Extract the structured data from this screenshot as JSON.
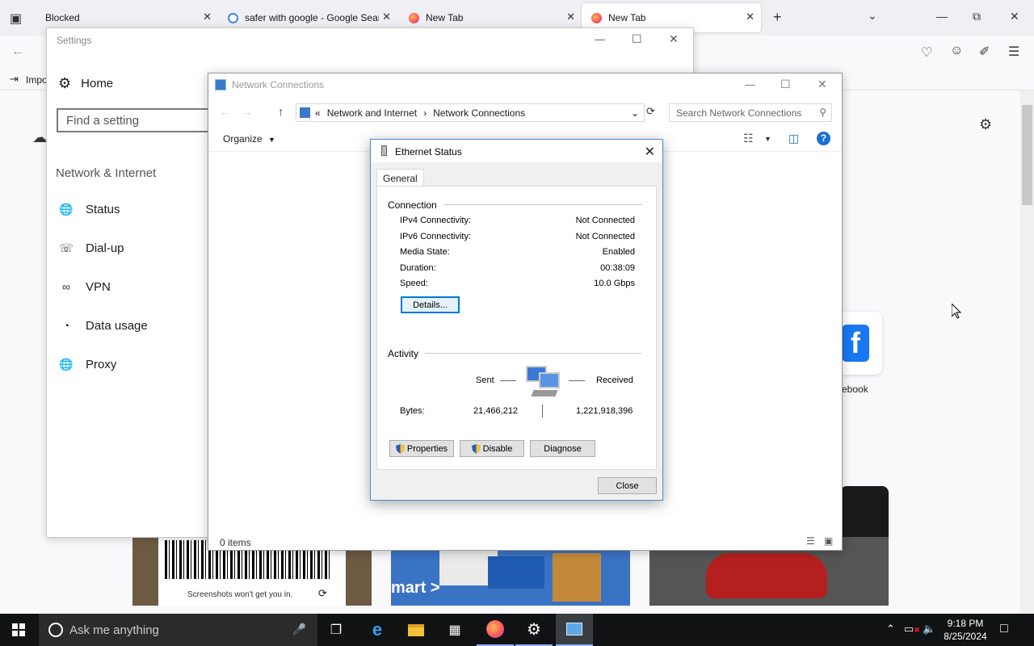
{
  "browser": {
    "tabs": [
      {
        "title": "Blocked",
        "active": false
      },
      {
        "title": "safer with google - Google Sear",
        "active": false
      },
      {
        "title": "New Tab",
        "active": false
      },
      {
        "title": "New Tab",
        "active": true
      }
    ],
    "bookmark_import": "Impo",
    "shortcut_label": "ebook",
    "tile_caption": "Screenshots won't get you in.",
    "tile_walmart_text": "mart >"
  },
  "settings": {
    "window_title": "Settings",
    "home_label": "Home",
    "search_placeholder": "Find a setting",
    "section_title": "Network & Internet",
    "nav": [
      {
        "label": "Status",
        "icon": "globe-icon"
      },
      {
        "label": "Dial-up",
        "icon": "dialup-icon"
      },
      {
        "label": "VPN",
        "icon": "vpn-icon"
      },
      {
        "label": "Data usage",
        "icon": "data-usage-icon"
      },
      {
        "label": "Proxy",
        "icon": "proxy-globe-icon"
      }
    ]
  },
  "network_connections": {
    "window_title": "Network Connections",
    "breadcrumb_prefix": "«",
    "breadcrumb": [
      "Network and Internet",
      "Network Connections"
    ],
    "search_placeholder": "Search Network Connections",
    "organize_label": "Organize",
    "status_text": "0 items"
  },
  "ethernet_status": {
    "title": "Ethernet Status",
    "tab": "General",
    "connection_group": "Connection",
    "rows": [
      {
        "label": "IPv4 Connectivity:",
        "value": "Not Connected"
      },
      {
        "label": "IPv6 Connectivity:",
        "value": "Not Connected"
      },
      {
        "label": "Media State:",
        "value": "Enabled"
      },
      {
        "label": "Duration:",
        "value": "00:38:09"
      },
      {
        "label": "Speed:",
        "value": "10.0 Gbps"
      }
    ],
    "details_button": "Details...",
    "activity_group": "Activity",
    "sent_label": "Sent",
    "received_label": "Received",
    "bytes_label": "Bytes:",
    "bytes_sent": "21,466,212",
    "bytes_received": "1,221,918,396",
    "properties_button": "Properties",
    "disable_button": "Disable",
    "diagnose_button": "Diagnose",
    "close_button": "Close"
  },
  "taskbar": {
    "search_placeholder": "Ask me anything",
    "time": "9:18 PM",
    "date": "8/25/2024"
  }
}
